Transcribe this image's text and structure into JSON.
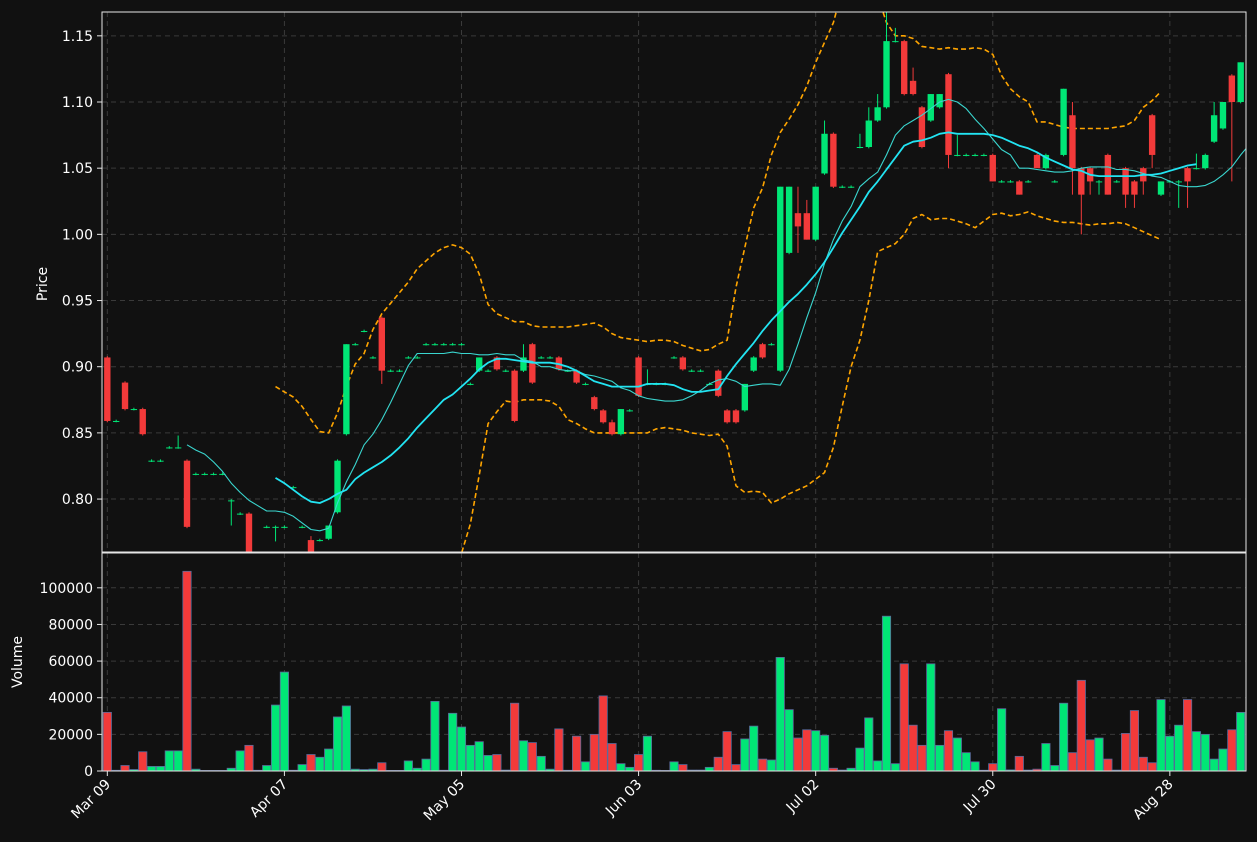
{
  "chart_data": {
    "type": "candlestick",
    "colors": {
      "background": "#111111",
      "up": "#00e676",
      "down": "#f23a3a",
      "ma_fast": "#3ad6cf",
      "ma_slow": "#22e4f2",
      "bollinger": "#ffa500",
      "volume_edge": "#5a6b9c",
      "text": "#ffffff",
      "grid": "#3a3a3a"
    },
    "price_panel": {
      "ylabel": "Price",
      "ylim": [
        0.76,
        1.168
      ],
      "yticks": [
        0.8,
        0.85,
        0.9,
        0.95,
        1.0,
        1.05,
        1.1,
        1.15
      ],
      "ytick_labels": [
        "0.80",
        "0.85",
        "0.90",
        "0.95",
        "1.00",
        "1.05",
        "1.10",
        "1.15"
      ]
    },
    "volume_panel": {
      "ylabel": "Volume",
      "ylim": [
        0,
        119000
      ],
      "yticks": [
        0,
        20000,
        40000,
        60000,
        80000,
        100000
      ],
      "ytick_labels": [
        "0",
        "20000",
        "40000",
        "60000",
        "80000",
        "100000"
      ]
    },
    "xlim": [
      -0.6,
      128.6
    ],
    "x_ticks": [
      {
        "index": 0,
        "label": "Mar 09"
      },
      {
        "index": 20,
        "label": "Apr 07"
      },
      {
        "index": 40,
        "label": "May 05"
      },
      {
        "index": 60,
        "label": "Jun 03"
      },
      {
        "index": 80,
        "label": "Jul 02"
      },
      {
        "index": 100,
        "label": "Jul 30"
      },
      {
        "index": 120,
        "label": "Aug 28"
      }
    ],
    "candles": [
      [
        0.907,
        0.908,
        0.858,
        0.859,
        32000
      ],
      [
        0.859,
        0.86,
        0.858,
        0.859,
        400
      ],
      [
        0.888,
        0.889,
        0.867,
        0.868,
        3000
      ],
      [
        0.868,
        0.869,
        0.867,
        0.868,
        800
      ],
      [
        0.868,
        0.869,
        0.848,
        0.849,
        10500
      ],
      [
        0.829,
        0.83,
        0.828,
        0.829,
        2500
      ],
      [
        0.829,
        0.83,
        0.828,
        0.829,
        2500
      ],
      [
        0.839,
        0.84,
        0.838,
        0.839,
        11000
      ],
      [
        0.839,
        0.848,
        0.838,
        0.839,
        11000
      ],
      [
        0.829,
        0.83,
        0.778,
        0.779,
        109000
      ],
      [
        0.819,
        0.82,
        0.818,
        0.819,
        1000
      ],
      [
        0.819,
        0.82,
        0.818,
        0.819,
        300
      ],
      [
        0.819,
        0.82,
        0.818,
        0.819,
        300
      ],
      [
        0.819,
        0.82,
        0.818,
        0.819,
        300
      ],
      [
        0.799,
        0.8,
        0.78,
        0.799,
        1500
      ],
      [
        0.789,
        0.79,
        0.788,
        0.789,
        11000
      ],
      [
        0.789,
        0.79,
        0.759,
        0.76,
        14000
      ],
      [
        0.759,
        0.76,
        0.758,
        0.759,
        400
      ],
      [
        0.779,
        0.78,
        0.778,
        0.779,
        3000
      ],
      [
        0.779,
        0.78,
        0.768,
        0.779,
        36000
      ],
      [
        0.779,
        0.78,
        0.778,
        0.779,
        54000
      ],
      [
        0.809,
        0.81,
        0.808,
        0.809,
        400
      ],
      [
        0.779,
        0.78,
        0.778,
        0.779,
        3500
      ],
      [
        0.769,
        0.772,
        0.758,
        0.759,
        9000
      ],
      [
        0.769,
        0.77,
        0.768,
        0.769,
        7500
      ],
      [
        0.77,
        0.78,
        0.769,
        0.78,
        12000
      ],
      [
        0.79,
        0.83,
        0.789,
        0.829,
        29500
      ],
      [
        0.849,
        0.917,
        0.848,
        0.917,
        35500
      ],
      [
        0.917,
        0.918,
        0.916,
        0.917,
        1000
      ],
      [
        0.927,
        0.928,
        0.926,
        0.927,
        800
      ],
      [
        0.907,
        0.908,
        0.906,
        0.907,
        1000
      ],
      [
        0.937,
        0.938,
        0.887,
        0.897,
        4500
      ],
      [
        0.897,
        0.898,
        0.896,
        0.897,
        300
      ],
      [
        0.897,
        0.898,
        0.896,
        0.897,
        300
      ],
      [
        0.907,
        0.908,
        0.906,
        0.907,
        5500
      ],
      [
        0.907,
        0.908,
        0.906,
        0.907,
        1500
      ],
      [
        0.917,
        0.918,
        0.916,
        0.917,
        6500
      ],
      [
        0.917,
        0.918,
        0.916,
        0.917,
        38000
      ],
      [
        0.917,
        0.918,
        0.916,
        0.917,
        400
      ],
      [
        0.917,
        0.918,
        0.916,
        0.917,
        31500
      ],
      [
        0.917,
        0.918,
        0.916,
        0.917,
        24000
      ],
      [
        0.887,
        0.888,
        0.886,
        0.887,
        14000
      ],
      [
        0.897,
        0.907,
        0.896,
        0.907,
        16000
      ],
      [
        0.897,
        0.898,
        0.896,
        0.897,
        8500
      ],
      [
        0.907,
        0.908,
        0.897,
        0.898,
        9000
      ],
      [
        0.897,
        0.898,
        0.896,
        0.897,
        500
      ],
      [
        0.897,
        0.898,
        0.858,
        0.859,
        37000
      ],
      [
        0.897,
        0.917,
        0.896,
        0.907,
        16500
      ],
      [
        0.917,
        0.918,
        0.887,
        0.888,
        15500
      ],
      [
        0.907,
        0.908,
        0.906,
        0.907,
        8000
      ],
      [
        0.907,
        0.908,
        0.906,
        0.907,
        1000
      ],
      [
        0.907,
        0.908,
        0.897,
        0.898,
        23000
      ],
      [
        0.897,
        0.898,
        0.896,
        0.897,
        400
      ],
      [
        0.897,
        0.898,
        0.887,
        0.888,
        19000
      ],
      [
        0.887,
        0.888,
        0.886,
        0.887,
        5000
      ],
      [
        0.877,
        0.878,
        0.867,
        0.868,
        20000
      ],
      [
        0.867,
        0.868,
        0.857,
        0.858,
        41000
      ],
      [
        0.858,
        0.86,
        0.848,
        0.849,
        15000
      ],
      [
        0.849,
        0.868,
        0.848,
        0.868,
        4000
      ],
      [
        0.867,
        0.868,
        0.866,
        0.867,
        2000
      ],
      [
        0.907,
        0.908,
        0.877,
        0.878,
        9000
      ],
      [
        0.887,
        0.898,
        0.886,
        0.887,
        19000
      ],
      [
        0.887,
        0.888,
        0.886,
        0.887,
        400
      ],
      [
        0.887,
        0.888,
        0.886,
        0.887,
        300
      ],
      [
        0.907,
        0.908,
        0.906,
        0.907,
        5000
      ],
      [
        0.907,
        0.908,
        0.897,
        0.898,
        3500
      ],
      [
        0.897,
        0.898,
        0.896,
        0.897,
        500
      ],
      [
        0.897,
        0.898,
        0.896,
        0.897,
        500
      ],
      [
        0.887,
        0.888,
        0.886,
        0.887,
        2000
      ],
      [
        0.897,
        0.898,
        0.877,
        0.878,
        7500
      ],
      [
        0.867,
        0.868,
        0.857,
        0.858,
        21500
      ],
      [
        0.867,
        0.868,
        0.857,
        0.858,
        3500
      ],
      [
        0.867,
        0.887,
        0.866,
        0.887,
        17500
      ],
      [
        0.897,
        0.908,
        0.896,
        0.907,
        24500
      ],
      [
        0.917,
        0.918,
        0.906,
        0.907,
        6500
      ],
      [
        0.917,
        0.918,
        0.916,
        0.917,
        6000
      ],
      [
        0.897,
        1.036,
        0.896,
        1.036,
        62000
      ],
      [
        0.986,
        1.036,
        0.985,
        1.036,
        33500
      ],
      [
        1.016,
        1.036,
        0.986,
        1.006,
        18000
      ],
      [
        1.016,
        1.026,
        0.996,
        0.996,
        22500
      ],
      [
        0.996,
        1.036,
        0.995,
        1.036,
        22000
      ],
      [
        1.046,
        1.086,
        1.045,
        1.076,
        19500
      ],
      [
        1.076,
        1.077,
        1.035,
        1.036,
        1500
      ],
      [
        1.036,
        1.037,
        1.035,
        1.036,
        500
      ],
      [
        1.036,
        1.037,
        1.035,
        1.036,
        1500
      ],
      [
        1.066,
        1.076,
        1.065,
        1.066,
        12500
      ],
      [
        1.066,
        1.096,
        1.065,
        1.086,
        29000
      ],
      [
        1.086,
        1.106,
        1.085,
        1.096,
        5500
      ],
      [
        1.096,
        1.186,
        1.095,
        1.146,
        84500
      ],
      [
        1.146,
        1.156,
        1.145,
        1.146,
        4000
      ],
      [
        1.146,
        1.147,
        1.105,
        1.106,
        58500
      ],
      [
        1.116,
        1.126,
        1.105,
        1.106,
        25000
      ],
      [
        1.096,
        1.097,
        1.065,
        1.066,
        14000
      ],
      [
        1.086,
        1.106,
        1.085,
        1.106,
        58500
      ],
      [
        1.096,
        1.106,
        1.095,
        1.106,
        14000
      ],
      [
        1.121,
        1.122,
        1.05,
        1.06,
        22000
      ],
      [
        1.06,
        1.075,
        1.059,
        1.06,
        18000
      ],
      [
        1.06,
        1.061,
        1.059,
        1.06,
        10000
      ],
      [
        1.06,
        1.061,
        1.059,
        1.06,
        5000
      ],
      [
        1.06,
        1.061,
        1.059,
        1.06,
        400
      ],
      [
        1.06,
        1.061,
        1.04,
        1.04,
        4000
      ],
      [
        1.04,
        1.041,
        1.039,
        1.04,
        34000
      ],
      [
        1.04,
        1.041,
        1.039,
        1.04,
        600
      ],
      [
        1.04,
        1.041,
        1.03,
        1.03,
        8000
      ],
      [
        1.04,
        1.041,
        1.039,
        1.04,
        500
      ],
      [
        1.06,
        1.061,
        1.05,
        1.05,
        1000
      ],
      [
        1.05,
        1.061,
        1.049,
        1.06,
        15000
      ],
      [
        1.04,
        1.041,
        1.039,
        1.04,
        3000
      ],
      [
        1.06,
        1.11,
        1.059,
        1.11,
        37000
      ],
      [
        1.09,
        1.1,
        1.03,
        1.05,
        10000
      ],
      [
        1.05,
        1.051,
        1.0,
        1.03,
        49500
      ],
      [
        1.05,
        1.051,
        1.03,
        1.04,
        17000
      ],
      [
        1.04,
        1.041,
        1.03,
        1.04,
        18000
      ],
      [
        1.06,
        1.061,
        1.03,
        1.03,
        6500
      ],
      [
        1.04,
        1.041,
        1.039,
        1.04,
        500
      ],
      [
        1.05,
        1.051,
        1.02,
        1.03,
        20500
      ],
      [
        1.04,
        1.041,
        1.02,
        1.03,
        33000
      ],
      [
        1.05,
        1.051,
        1.03,
        1.04,
        7500
      ],
      [
        1.09,
        1.091,
        1.05,
        1.06,
        4500
      ],
      [
        1.03,
        1.04,
        1.029,
        1.04,
        39000
      ],
      [
        1.04,
        1.041,
        1.039,
        1.04,
        19000
      ],
      [
        1.04,
        1.041,
        1.02,
        1.04,
        25000
      ],
      [
        1.05,
        1.051,
        1.02,
        1.04,
        39000
      ],
      [
        1.05,
        1.061,
        1.049,
        1.05,
        21500
      ],
      [
        1.05,
        1.061,
        1.049,
        1.06,
        20000
      ],
      [
        1.07,
        1.1,
        1.069,
        1.09,
        6500
      ],
      [
        1.08,
        1.1,
        1.079,
        1.1,
        12000
      ],
      [
        1.12,
        1.121,
        1.04,
        1.1,
        22500
      ],
      [
        1.1,
        1.13,
        1.099,
        1.13,
        32000
      ]
    ],
    "ma_fast_start": 9,
    "ma_fast": [
      0.841,
      0.837,
      0.834,
      0.828,
      0.821,
      0.812,
      0.805,
      0.799,
      0.795,
      0.791,
      0.791,
      0.79,
      0.787,
      0.782,
      0.777,
      0.776,
      0.778,
      0.797,
      0.813,
      0.826,
      0.841,
      0.849,
      0.86,
      0.873,
      0.887,
      0.901,
      0.91,
      0.91,
      0.91,
      0.91,
      0.911,
      0.91,
      0.91,
      0.909,
      0.909,
      0.91,
      0.909,
      0.909,
      0.905,
      0.904,
      0.9,
      0.9,
      0.898,
      0.897,
      0.897,
      0.894,
      0.893,
      0.891,
      0.889,
      0.884,
      0.882,
      0.878,
      0.876,
      0.875,
      0.874,
      0.874,
      0.875,
      0.878,
      0.882,
      0.887,
      0.89,
      0.891,
      0.889,
      0.885,
      0.886,
      0.887,
      0.887,
      0.886,
      0.898,
      0.917,
      0.937,
      0.956,
      0.978,
      0.996,
      1.01,
      1.021,
      1.036,
      1.042,
      1.047,
      1.06,
      1.075,
      1.082,
      1.086,
      1.09,
      1.095,
      1.1,
      1.102,
      1.1,
      1.095,
      1.087,
      1.08,
      1.072,
      1.064,
      1.06,
      1.05,
      1.05,
      1.049,
      1.048,
      1.047,
      1.047,
      1.048,
      1.05,
      1.051,
      1.051,
      1.051,
      1.049,
      1.049,
      1.048,
      1.046,
      1.044,
      1.043,
      1.04,
      1.037,
      1.036,
      1.036,
      1.037,
      1.04,
      1.045,
      1.051,
      1.06,
      1.068
    ],
    "ma_slow_start": 19,
    "ma_slow": [
      0.816,
      0.812,
      0.807,
      0.802,
      0.798,
      0.797,
      0.8,
      0.804,
      0.807,
      0.815,
      0.82,
      0.824,
      0.828,
      0.833,
      0.839,
      0.846,
      0.854,
      0.861,
      0.868,
      0.875,
      0.879,
      0.885,
      0.891,
      0.898,
      0.903,
      0.906,
      0.906,
      0.905,
      0.904,
      0.903,
      0.903,
      0.903,
      0.902,
      0.9,
      0.897,
      0.893,
      0.889,
      0.887,
      0.885,
      0.885,
      0.885,
      0.885,
      0.887,
      0.887,
      0.887,
      0.886,
      0.883,
      0.881,
      0.881,
      0.882,
      0.883,
      0.893,
      0.902,
      0.91,
      0.918,
      0.927,
      0.935,
      0.942,
      0.949,
      0.955,
      0.962,
      0.97,
      0.979,
      0.99,
      1.001,
      1.011,
      1.021,
      1.032,
      1.04,
      1.049,
      1.058,
      1.067,
      1.07,
      1.071,
      1.073,
      1.076,
      1.077,
      1.076,
      1.076,
      1.076,
      1.076,
      1.075,
      1.073,
      1.07,
      1.067,
      1.065,
      1.062,
      1.058,
      1.055,
      1.052,
      1.049,
      1.048,
      1.045,
      1.044,
      1.044,
      1.044,
      1.044,
      1.044,
      1.045,
      1.045,
      1.046,
      1.048,
      1.05,
      1.052,
      1.053
    ],
    "boll_start": 19,
    "boll_upper": [
      0.885,
      0.881,
      0.877,
      0.87,
      0.86,
      0.851,
      0.85,
      0.865,
      0.885,
      0.902,
      0.91,
      0.928,
      0.94,
      0.948,
      0.956,
      0.964,
      0.974,
      0.98,
      0.986,
      0.99,
      0.992,
      0.99,
      0.985,
      0.97,
      0.947,
      0.94,
      0.937,
      0.934,
      0.934,
      0.931,
      0.93,
      0.93,
      0.93,
      0.93,
      0.931,
      0.932,
      0.933,
      0.93,
      0.925,
      0.922,
      0.921,
      0.92,
      0.919,
      0.92,
      0.92,
      0.919,
      0.916,
      0.914,
      0.912,
      0.913,
      0.917,
      0.92,
      0.96,
      0.99,
      1.02,
      1.035,
      1.06,
      1.077,
      1.087,
      1.098,
      1.112,
      1.13,
      1.145,
      1.16,
      1.185,
      1.2,
      1.21,
      1.2,
      1.18,
      1.16,
      1.15,
      1.15,
      1.148,
      1.142,
      1.141,
      1.14,
      1.141,
      1.14,
      1.14,
      1.141,
      1.14,
      1.136,
      1.12,
      1.11,
      1.104,
      1.1,
      1.085,
      1.085,
      1.083,
      1.081,
      1.08,
      1.08,
      1.08,
      1.08,
      1.08,
      1.081,
      1.082,
      1.086,
      1.096,
      1.101,
      1.108
    ],
    "boll_lower": [
      0.72,
      0.72,
      0.72,
      0.72,
      0.72,
      0.72,
      0.72,
      0.72,
      0.72,
      0.72,
      0.72,
      0.72,
      0.72,
      0.72,
      0.72,
      0.72,
      0.72,
      0.72,
      0.72,
      0.72,
      0.743,
      0.759,
      0.781,
      0.818,
      0.857,
      0.866,
      0.874,
      0.873,
      0.875,
      0.875,
      0.875,
      0.874,
      0.87,
      0.86,
      0.857,
      0.853,
      0.85,
      0.85,
      0.85,
      0.85,
      0.85,
      0.85,
      0.85,
      0.853,
      0.854,
      0.853,
      0.852,
      0.85,
      0.849,
      0.848,
      0.849,
      0.84,
      0.81,
      0.805,
      0.806,
      0.805,
      0.797,
      0.8,
      0.804,
      0.807,
      0.81,
      0.815,
      0.82,
      0.839,
      0.87,
      0.9,
      0.92,
      0.95,
      0.987,
      0.99,
      0.993,
      1.0,
      1.012,
      1.015,
      1.011,
      1.012,
      1.012,
      1.01,
      1.008,
      1.005,
      1.01,
      1.015,
      1.016,
      1.014,
      1.015,
      1.017,
      1.014,
      1.012,
      1.01,
      1.009,
      1.009,
      1.008,
      1.007,
      1.008,
      1.008,
      1.009,
      1.008,
      1.005,
      1.002,
      0.999,
      0.996
    ]
  }
}
